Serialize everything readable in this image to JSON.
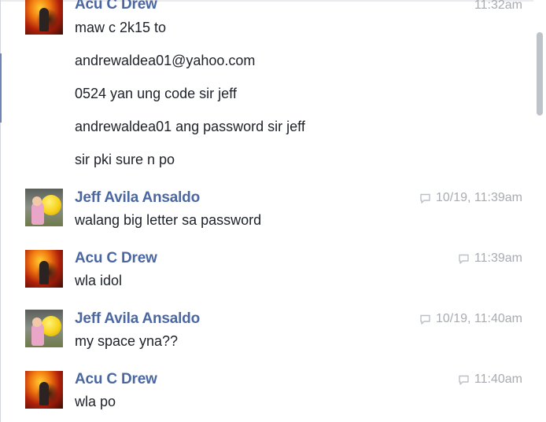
{
  "messages": [
    {
      "sender": "Acu C Drew",
      "time": "11:32am",
      "avatar": "acu-avatar",
      "lines": [
        "maw c 2k15 to",
        "andrewaldea01@yahoo.com",
        "0524 yan ung code sir jeff",
        "andrewaldea01 ang password sir jeff",
        "sir pki sure n po"
      ]
    },
    {
      "sender": "Jeff Avila Ansaldo",
      "time": "10/19, 11:39am",
      "avatar": "jeff-avatar",
      "lines": [
        "walang big letter sa password"
      ]
    },
    {
      "sender": "Acu C Drew",
      "time": "11:39am",
      "avatar": "acu-avatar",
      "lines": [
        "wla idol"
      ]
    },
    {
      "sender": "Jeff Avila Ansaldo",
      "time": "10/19, 11:40am",
      "avatar": "jeff-avatar",
      "lines": [
        "my space yna??"
      ]
    },
    {
      "sender": "Acu C Drew",
      "time": "11:40am",
      "avatar": "acu-avatar",
      "lines": [
        "wla po"
      ]
    }
  ],
  "colors": {
    "sender_name": "#4b67a1",
    "message_text": "#1d2129",
    "timestamp": "#a8abb1"
  },
  "icons": {
    "timestamp_icon": "reply-bubble-icon"
  }
}
